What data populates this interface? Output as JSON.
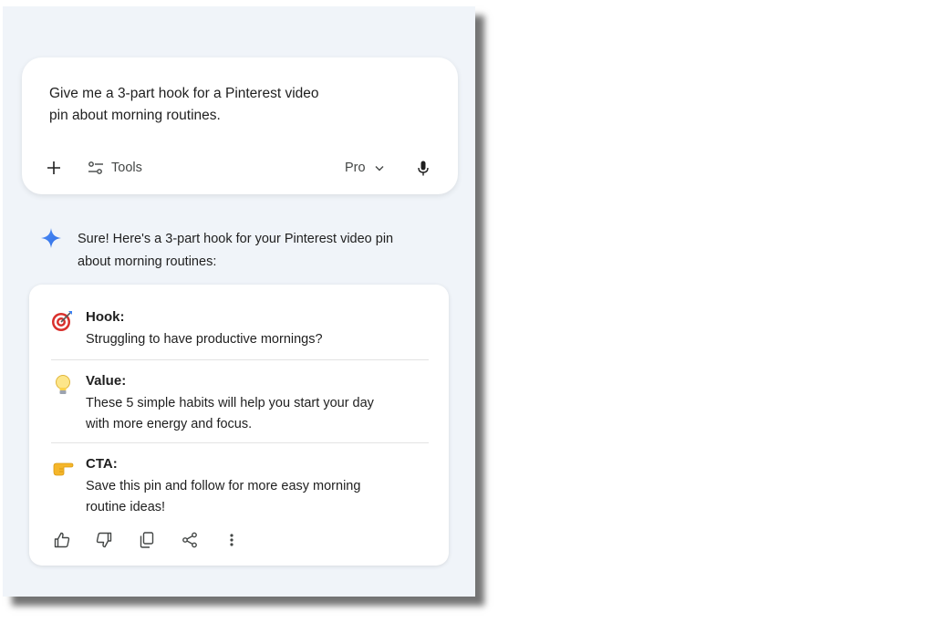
{
  "prompt": {
    "text": "Give me a 3-part hook for a Pinterest video pin about morning routines.",
    "tools_label": "Tools",
    "model_label": "Pro"
  },
  "reply": {
    "intro": "Sure! Here's a 3-part hook for your Pinterest video pin about morning routines:",
    "sections": [
      {
        "icon": "target-icon",
        "title": "Hook:",
        "body": "Struggling to have productive mornings?"
      },
      {
        "icon": "lightbulb-icon",
        "title": "Value:",
        "body": "These 5 simple habits will help you start your day with more energy and focus."
      },
      {
        "icon": "pointing-hand-icon",
        "title": "CTA:",
        "body": "Save this pin and follow for more easy morning routine ideas!"
      }
    ]
  },
  "colors": {
    "panel_bg": "#f0f4f9",
    "gemini_blue": "#4285f4",
    "icon_gray": "#444746"
  }
}
